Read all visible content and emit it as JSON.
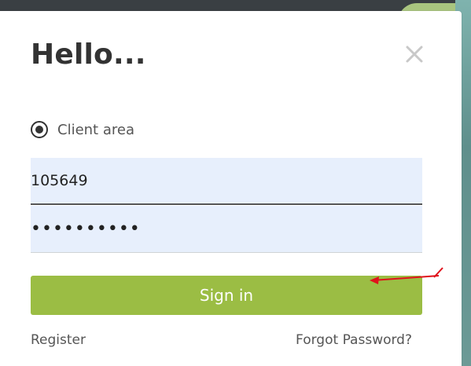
{
  "modal": {
    "title": "Hello...",
    "close_icon": "close-icon",
    "radio": {
      "label": "Client area",
      "selected": true
    },
    "username": {
      "value": "105649",
      "placeholder": ""
    },
    "password": {
      "value": "••••••••••",
      "placeholder": ""
    },
    "signin_label": "Sign in",
    "register_label": "Register",
    "forgot_label": "Forgot Password?"
  },
  "colors": {
    "accent_button": "#9bbd44",
    "input_bg": "#e7effc",
    "annotation_arrow": "#e0121b"
  },
  "annotation_icon": "red-arrow-icon"
}
